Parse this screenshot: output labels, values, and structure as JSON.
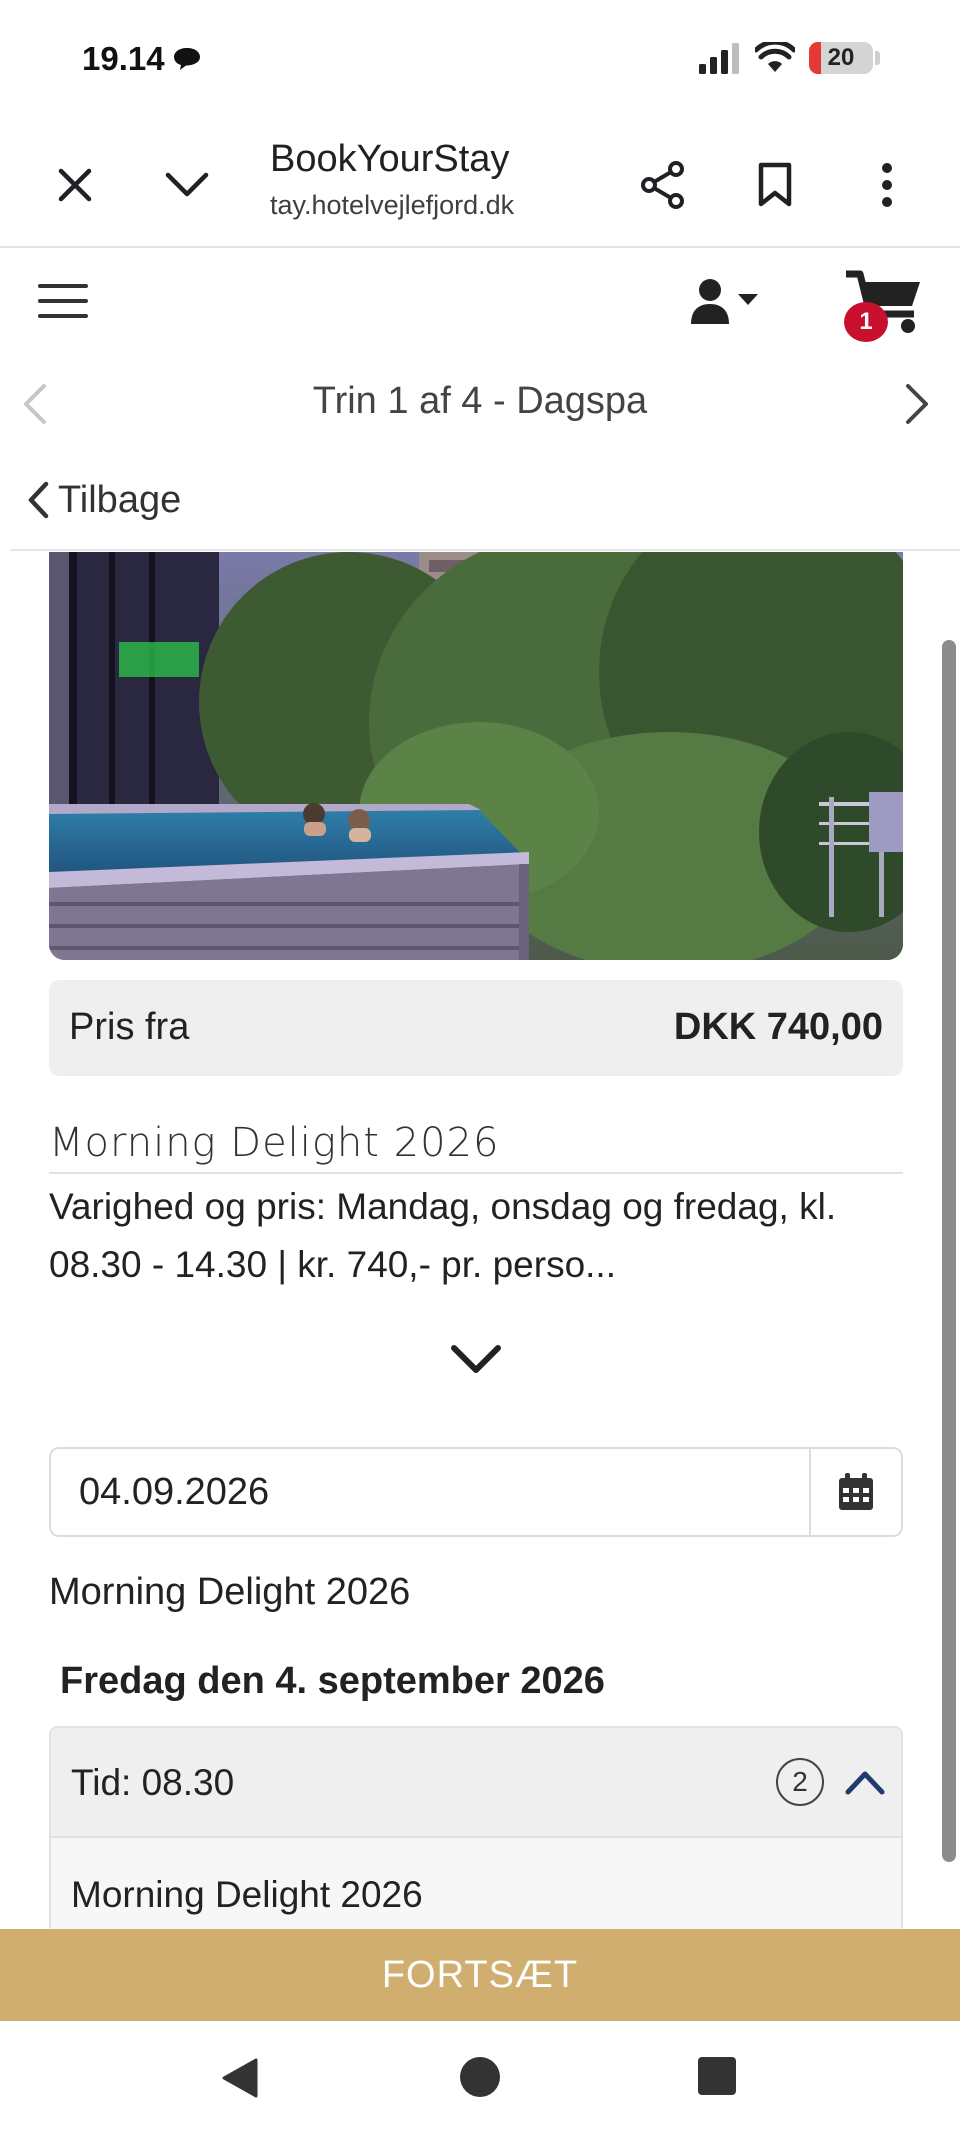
{
  "status_bar": {
    "time": "19.14",
    "battery": "20"
  },
  "browser": {
    "title": "BookYourStay",
    "url": "tay.hotelvejlefjord.dk"
  },
  "header": {
    "cart_count": "1"
  },
  "steps": {
    "label": "Trin 1 af 4 - Dagspa"
  },
  "back_label": "Tilbage",
  "price": {
    "label": "Pris fra",
    "value": "DKK 740,00"
  },
  "product": {
    "title": "Morning Delight 2026",
    "description": "Varighed og pris: Mandag, onsdag og fredag, kl. 08.30 - 14.30 | kr. 740,- pr. perso..."
  },
  "date_picker": {
    "value": "04.09.2026"
  },
  "availability": {
    "package_name": "Morning Delight 2026",
    "date_heading": "Fredag den 4. september 2026",
    "slots": [
      {
        "time_label": "Tid: 08.30",
        "count": "2",
        "items": [
          "Morning Delight 2026"
        ]
      }
    ]
  },
  "continue_label": "FORTSÆT",
  "colors": {
    "accent_gold": "#cfae70",
    "badge_red": "#c8102e",
    "chevron_blue": "#1f3b6e"
  }
}
